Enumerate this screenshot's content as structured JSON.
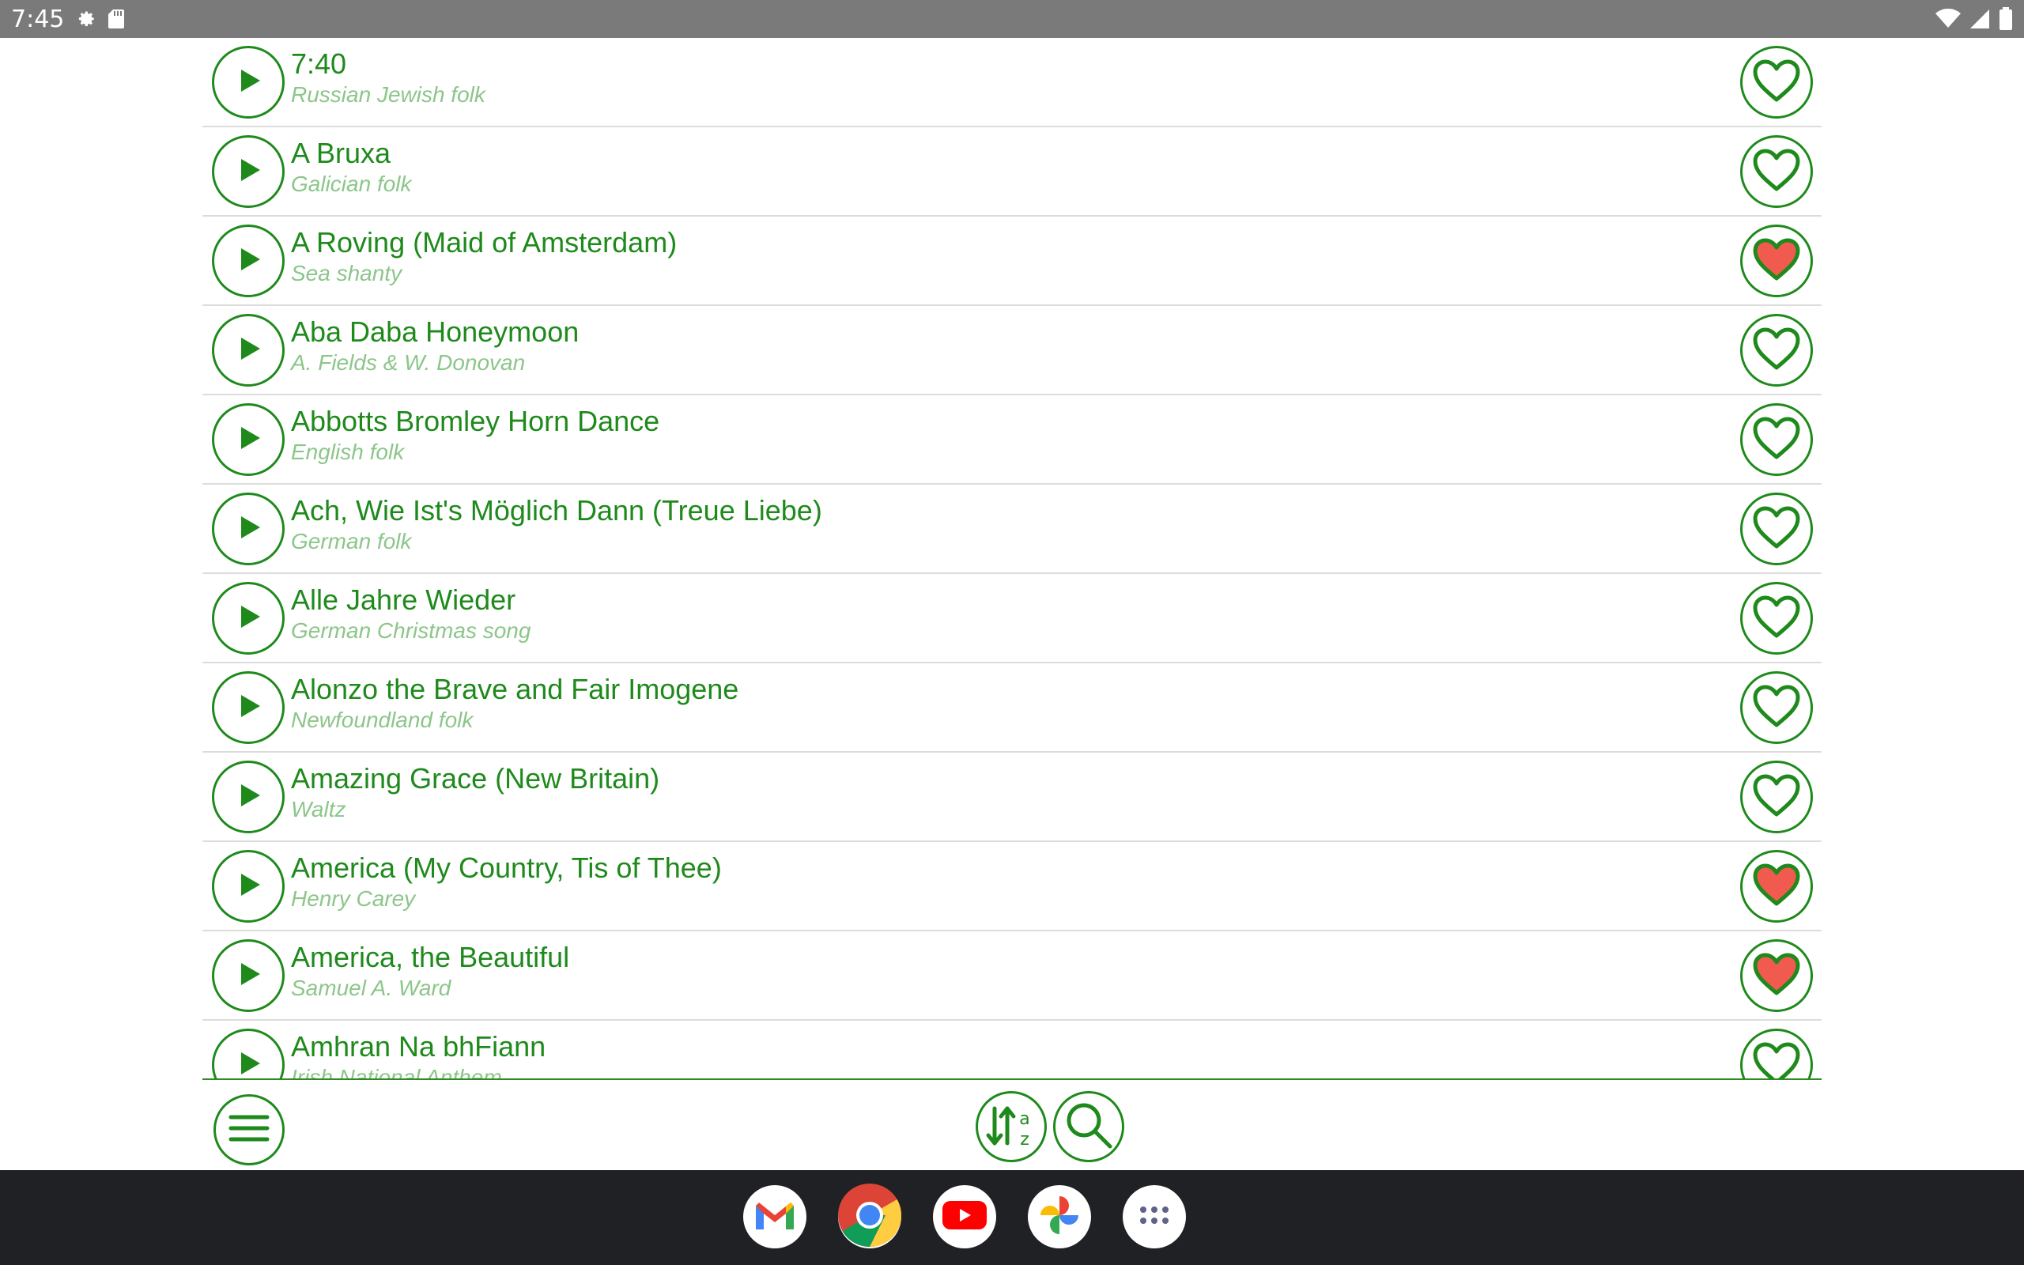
{
  "status_bar": {
    "time": "7:45"
  },
  "songs": [
    {
      "title": "7:40",
      "subtitle": "Russian Jewish folk",
      "favorite": false
    },
    {
      "title": "A Bruxa",
      "subtitle": "Galician folk",
      "favorite": false
    },
    {
      "title": "A Roving (Maid of Amsterdam)",
      "subtitle": "Sea shanty",
      "favorite": true
    },
    {
      "title": "Aba Daba Honeymoon",
      "subtitle": "A. Fields & W. Donovan",
      "favorite": false
    },
    {
      "title": "Abbotts Bromley Horn Dance",
      "subtitle": "English folk",
      "favorite": false
    },
    {
      "title": "Ach, Wie Ist's Möglich Dann (Treue Liebe)",
      "subtitle": "German folk",
      "favorite": false
    },
    {
      "title": "Alle Jahre Wieder",
      "subtitle": "German Christmas song",
      "favorite": false
    },
    {
      "title": "Alonzo the Brave and Fair Imogene",
      "subtitle": "Newfoundland folk",
      "favorite": false
    },
    {
      "title": "Amazing Grace (New Britain)",
      "subtitle": "Waltz",
      "favorite": false
    },
    {
      "title": "America (My Country, Tis of Thee)",
      "subtitle": "Henry Carey",
      "favorite": true
    },
    {
      "title": "America, the Beautiful",
      "subtitle": "Samuel A. Ward",
      "favorite": true
    },
    {
      "title": "Amhran Na bhFiann",
      "subtitle": "Irish National Anthem",
      "favorite": false
    }
  ],
  "colors": {
    "accent": "#1f8a1c",
    "subtitle": "#8cc68a",
    "heart_fill": "#f05a4f",
    "status_bar": "#7a7a7a",
    "dock": "#202124"
  },
  "toolbar": {
    "menu_icon": "hamburger-menu-icon",
    "sort_icon": "sort-az-icon",
    "search_icon": "search-icon"
  },
  "dock": {
    "apps": [
      "gmail-icon",
      "chrome-icon",
      "youtube-icon",
      "photos-icon",
      "app-drawer-icon"
    ]
  }
}
